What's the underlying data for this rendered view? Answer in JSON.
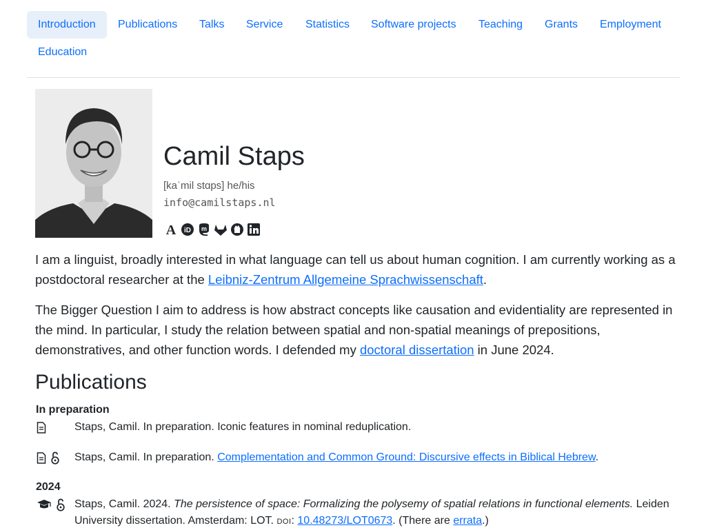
{
  "nav": {
    "items": [
      {
        "label": "Introduction",
        "active": true
      },
      {
        "label": "Publications"
      },
      {
        "label": "Talks"
      },
      {
        "label": "Service"
      },
      {
        "label": "Statistics"
      },
      {
        "label": "Software projects"
      },
      {
        "label": "Teaching"
      },
      {
        "label": "Grants"
      },
      {
        "label": "Employment"
      },
      {
        "label": "Education"
      }
    ]
  },
  "profile": {
    "name": "Camil Staps",
    "pronunciation": "[kaˈmil stɑps] he/his",
    "email": "info@camilstaps.nl",
    "socials": [
      "academia-icon",
      "orcid-icon",
      "mastodon-icon",
      "gitlab-icon",
      "github-icon",
      "linkedin-icon"
    ]
  },
  "intro": {
    "p1_before": "I am a linguist, broadly interested in what language can tell us about human cognition. I am currently working as a postdoctoral researcher at the ",
    "p1_link": "Leibniz-Zentrum Allgemeine Sprachwissenschaft",
    "p1_after": ".",
    "p2_before": "The Bigger Question I aim to address is how abstract concepts like causation and evidentiality are represented in the mind. In particular, I study the relation between spatial and non-spatial meanings of prepositions, demonstratives, and other function words. I defended my ",
    "p2_link": "doctoral dissertation",
    "p2_after": " in June 2024."
  },
  "publications": {
    "heading": "Publications",
    "in_prep_heading": "In preparation",
    "year_heading": "2024",
    "items": [
      {
        "text": "Staps, Camil. In preparation. Iconic features in nominal reduplication.",
        "icons": [
          "document-icon"
        ]
      },
      {
        "prefix": "Staps, Camil. In preparation. ",
        "link": "Complementation and Common Ground: Discursive effects in Biblical Hebrew",
        "suffix": ".",
        "icons": [
          "document-icon",
          "open-access-icon"
        ]
      },
      {
        "prefix": "Staps, Camil. 2024. ",
        "title": "The persistence of space: Formalizing the polysemy of spatial relations in functional elements.",
        "mid": " Leiden University dissertation. Amsterdam: LOT. ",
        "doi_label": "DOI",
        "doi_sep": ": ",
        "doi": "10.48273/LOT0673",
        "after_doi": ". (There are ",
        "errata": "errata",
        "end": ".)",
        "icons": [
          "graduation-cap-icon",
          "open-access-icon"
        ]
      }
    ]
  },
  "colors": {
    "link": "#0d6efd",
    "active_tab_bg": "#e7effa",
    "text": "#212529"
  }
}
